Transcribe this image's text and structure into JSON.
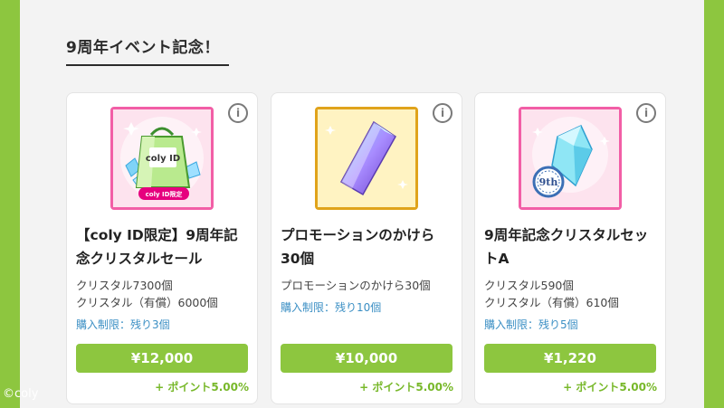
{
  "section": {
    "title": "9周年イベント記念！"
  },
  "cards": [
    {
      "name_line1": "【coly ID限定】9周年記",
      "name_line2": "念クリスタルセール",
      "desc_line1": "クリスタル7300個",
      "desc_line2": "クリスタル（有償）6000個",
      "limit": "購入制限：残り3個",
      "price": "¥12,000",
      "points": "+ ポイント5.00%",
      "thumb_icon": "shopping-bag-crystal-icon",
      "badge_text": "coly ID限定",
      "bag_logo": "coly ID"
    },
    {
      "name_line1": "プロモーションのかけら",
      "name_line2": "30個",
      "desc_line1": "プロモーションのかけら30個",
      "limit": "購入制限：残り10個",
      "price": "¥10,000",
      "points": "+ ポイント5.00%",
      "thumb_icon": "promotion-shard-icon"
    },
    {
      "name_line1": "9周年記念クリスタルセッ",
      "name_line2": "トA",
      "desc_line1": "クリスタル590個",
      "desc_line2": "クリスタル（有償）610個",
      "limit": "購入制限：残り5個",
      "price": "¥1,220",
      "points": "+ ポイント5.00%",
      "thumb_icon": "crystal-9th-icon",
      "badge_text": "9th"
    }
  ],
  "footer": {
    "copyright": "©coly"
  },
  "colors": {
    "brand_green": "#8dc63f",
    "limit_blue": "#3b8fc4",
    "pink_frame": "#f25ea6",
    "gold_frame": "#e0a31b"
  }
}
